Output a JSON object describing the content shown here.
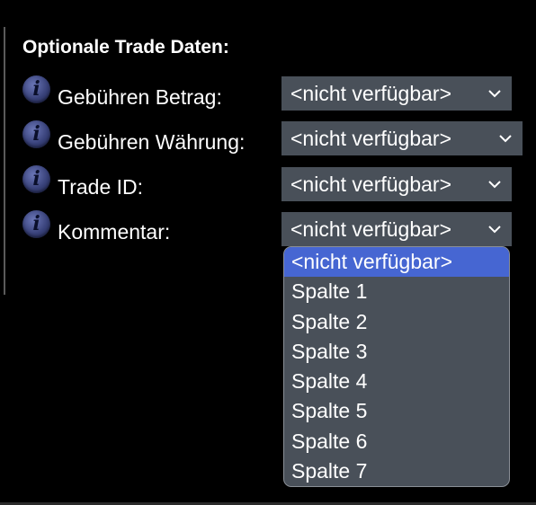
{
  "section": {
    "title": "Optionale Trade Daten:"
  },
  "fields": [
    {
      "label": "Gebühren Betrag:",
      "value": "<nicht verfügbar>",
      "icon": "info-icon"
    },
    {
      "label": "Gebühren Währung:",
      "value": "<nicht verfügbar>",
      "icon": "info-icon"
    },
    {
      "label": "Trade ID:",
      "value": "<nicht verfügbar>",
      "icon": "info-icon"
    },
    {
      "label": "Kommentar:",
      "value": "<nicht verfügbar>",
      "icon": "info-icon"
    }
  ],
  "dropdown": {
    "options": [
      "<nicht verfügbar>",
      "Spalte 1",
      "Spalte 2",
      "Spalte 3",
      "Spalte 4",
      "Spalte 5",
      "Spalte 6",
      "Spalte 7"
    ],
    "selected_index": 0
  },
  "colors": {
    "background": "#000000",
    "select_background": "#495059",
    "selected_option": "#4666d2",
    "icon": "#39427a"
  }
}
